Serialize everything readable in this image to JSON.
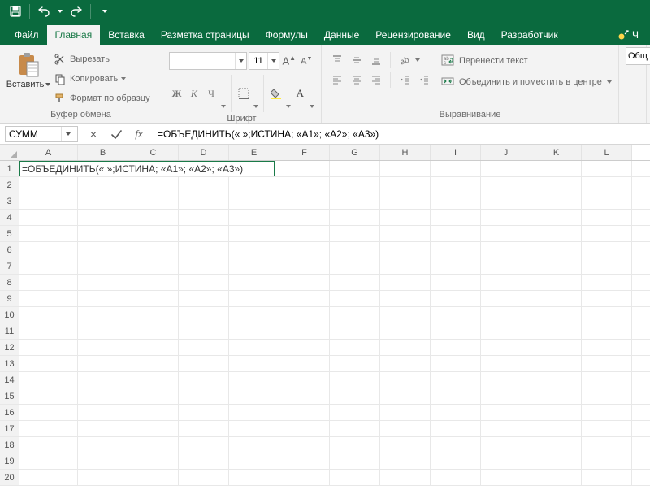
{
  "qat": {
    "save": "save",
    "undo": "undo",
    "redo": "redo"
  },
  "tabsRow": {
    "file": "Файл",
    "home": "Главная",
    "insert": "Вставка",
    "layout": "Разметка страницы",
    "formulas": "Формулы",
    "data": "Данные",
    "review": "Рецензирование",
    "view": "Вид",
    "developer": "Разработчик",
    "helpHint": "Ч"
  },
  "ribbon": {
    "clipboard": {
      "paste": "Вставить",
      "cut": "Вырезать",
      "copy": "Копировать",
      "formatPainter": "Формат по образцу",
      "groupLabel": "Буфер обмена"
    },
    "font": {
      "fontName": "",
      "fontSize": "11",
      "bold": "Ж",
      "italic": "К",
      "underline": "Ч",
      "increase": "A",
      "decrease": "A",
      "groupLabel": "Шрифт"
    },
    "alignment": {
      "wrapText": "Перенести текст",
      "mergeCenter": "Объединить и поместить в центре",
      "groupLabel": "Выравнивание"
    },
    "number": {
      "format": "Общ"
    }
  },
  "formulaBar": {
    "nameBox": "СУММ",
    "formula": "=ОБЪЕДИНИТЬ(« »;ИСТИНА; «А1»; «А2»; «А3»)",
    "cancel": "×",
    "enter": "✓",
    "fx": "fx"
  },
  "gridData": {
    "columns": [
      "A",
      "B",
      "C",
      "D",
      "E",
      "F",
      "G",
      "H",
      "I",
      "J",
      "K",
      "L"
    ],
    "rows": 20,
    "cellA1": "=ОБЪЕДИНИТЬ(« »;ИСТИНА; «А1»; «А2»; «А3»)"
  }
}
